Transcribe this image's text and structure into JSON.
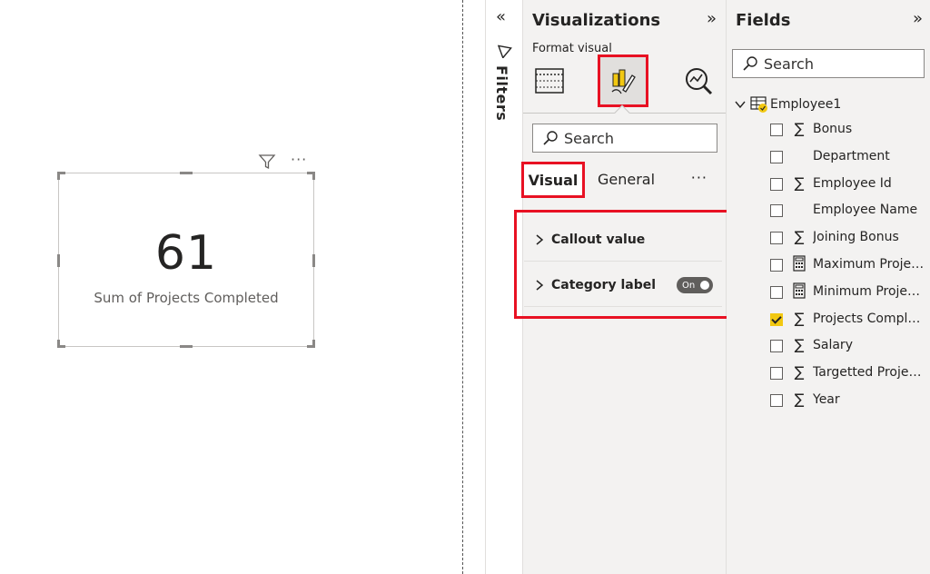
{
  "canvas": {
    "card": {
      "value": "61",
      "label": "Sum of Projects Completed"
    },
    "visual_header": {
      "filter_icon": "funnel-icon",
      "more_icon": "ellipsis-icon",
      "more_text": "···"
    }
  },
  "filters_pane": {
    "title": "Filters",
    "collapse_glyph": "«",
    "icon": "funnel-outline-icon"
  },
  "visualizations": {
    "title": "Visualizations",
    "expand_glyph": "»",
    "subtitle": "Format visual",
    "tabs": [
      {
        "name": "build-visual",
        "icon": "table-grid-icon"
      },
      {
        "name": "format-visual",
        "icon": "paintbrush-icon",
        "selected": true
      },
      {
        "name": "analytics",
        "icon": "magnifier-chart-icon"
      }
    ],
    "search_placeholder": "Search",
    "format_tabs": {
      "visual": "Visual",
      "general": "General",
      "more": "···"
    },
    "cards": [
      {
        "label": "Callout value"
      },
      {
        "label": "Category label",
        "toggle": "On"
      }
    ],
    "highlight_color": "#e81123"
  },
  "fields": {
    "title": "Fields",
    "expand_glyph": "»",
    "search_placeholder": "Search",
    "table": {
      "name": "Employee1",
      "icon": "table-icon"
    },
    "items": [
      {
        "name": "Bonus",
        "type": "∑",
        "checked": false
      },
      {
        "name": "Department",
        "type": "",
        "checked": false
      },
      {
        "name": "Employee Id",
        "type": "∑",
        "checked": false
      },
      {
        "name": "Employee Name",
        "type": "",
        "checked": false
      },
      {
        "name": "Joining Bonus",
        "type": "∑",
        "checked": false
      },
      {
        "name": "Maximum Projects",
        "type": "calc",
        "checked": false
      },
      {
        "name": "Minimum Projects",
        "type": "calc",
        "checked": false
      },
      {
        "name": "Projects Complet...",
        "type": "∑",
        "checked": true
      },
      {
        "name": "Salary",
        "type": "∑",
        "checked": false
      },
      {
        "name": "Targetted Projects",
        "type": "∑",
        "checked": false
      },
      {
        "name": "Year",
        "type": "∑",
        "checked": false
      }
    ],
    "accent_color": "#f2c811"
  }
}
